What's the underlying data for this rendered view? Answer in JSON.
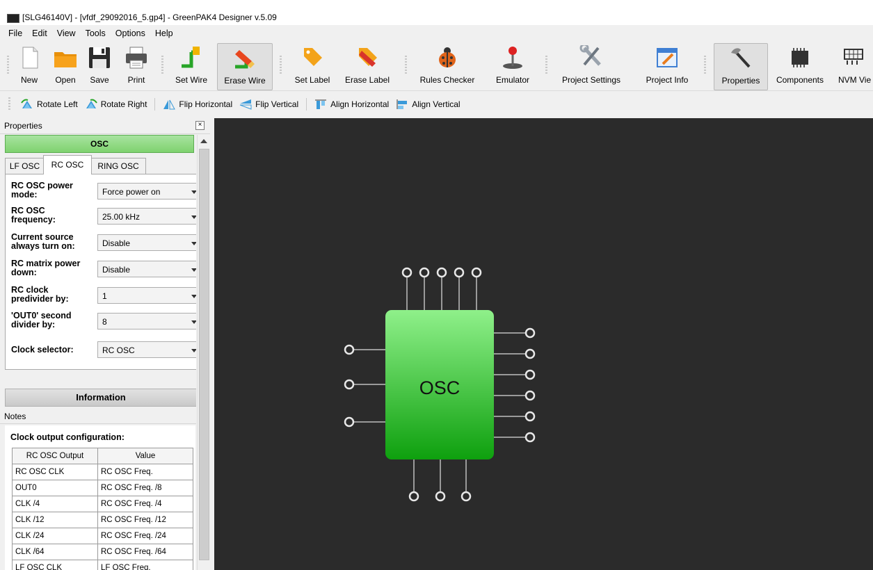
{
  "window": {
    "title": "[SLG46140V] - [vfdf_29092016_5.gp4] - GreenPAK4 Designer v.5.09"
  },
  "menu": [
    "File",
    "Edit",
    "View",
    "Tools",
    "Options",
    "Help"
  ],
  "toolbar": {
    "new": "New",
    "open": "Open",
    "save": "Save",
    "print": "Print",
    "set_wire": "Set Wire",
    "erase_wire": "Erase Wire",
    "set_label": "Set Label",
    "erase_label": "Erase Label",
    "rules_checker": "Rules Checker",
    "emulator": "Emulator",
    "project_settings": "Project Settings",
    "project_info": "Project Info",
    "properties": "Properties",
    "components": "Components",
    "nvm_view": "NVM Vie"
  },
  "toolbar2": {
    "rotate_left": "Rotate Left",
    "rotate_right": "Rotate Right",
    "flip_horizontal": "Flip Horizontal",
    "flip_vertical": "Flip Vertical",
    "align_horizontal": "Align Horizontal",
    "align_vertical": "Align Vertical"
  },
  "panel": {
    "title": "Properties",
    "component": "OSC",
    "tabs": [
      "LF OSC",
      "RC OSC",
      "RING OSC"
    ],
    "active_tab": "RC OSC",
    "props": [
      {
        "label": "RC OSC power mode:",
        "value": "Force power on"
      },
      {
        "label": "RC OSC frequency:",
        "value": "25.00 kHz"
      },
      {
        "label": "Current source always turn on:",
        "value": "Disable"
      },
      {
        "label": "RC matrix power down:",
        "value": "Disable"
      },
      {
        "label": "RC clock predivider by:",
        "value": "1"
      },
      {
        "label": "'OUT0' second divider by:",
        "value": "8"
      },
      {
        "label": "Clock selector:",
        "value": "RC OSC"
      }
    ],
    "information": "Information",
    "notes": "Notes",
    "clock_cfg_title": "Clock output configuration:",
    "table": {
      "headers": [
        "RC OSC Output",
        "Value"
      ],
      "rows": [
        [
          "RC OSC CLK",
          "RC OSC Freq."
        ],
        [
          "OUT0",
          "RC OSC Freq. /8"
        ],
        [
          "CLK /4",
          "RC OSC Freq. /4"
        ],
        [
          "CLK /12",
          "RC OSC Freq. /12"
        ],
        [
          "CLK /24",
          "RC OSC Freq. /24"
        ],
        [
          "CLK /64",
          "RC OSC Freq. /64"
        ],
        [
          "LF OSC CLK",
          "LF OSC Freq."
        ]
      ]
    }
  },
  "canvas": {
    "block_label": "OSC"
  },
  "colors": {
    "canvas_bg": "#2b2b2b",
    "block_top": "#8ff08a",
    "block_bottom": "#0ea00e",
    "pin": "#e8e8e8",
    "wire": "#9a9a9a"
  }
}
